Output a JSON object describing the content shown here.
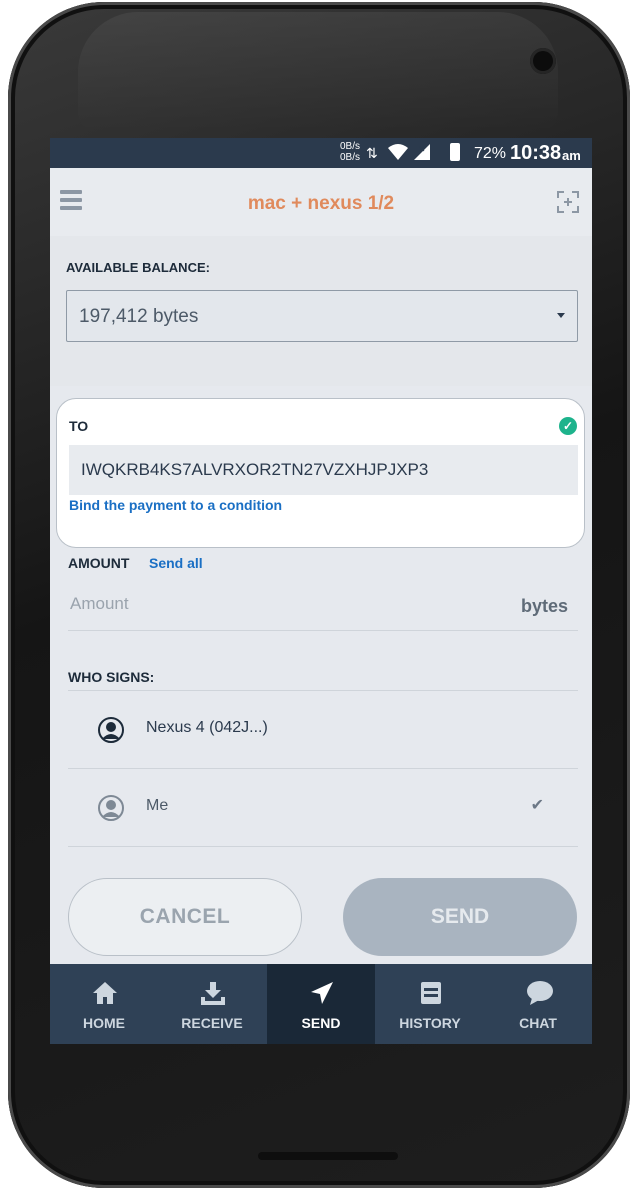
{
  "statusbar": {
    "net_up": "0B/s",
    "net_down": "0B/s",
    "battery_pct": "72%",
    "time": "10:38",
    "ampm": "am"
  },
  "header": {
    "title": "mac + nexus 1/2",
    "menu_icon": "hamburger-icon",
    "scan_icon": "qr-scan-icon"
  },
  "balance": {
    "label": "AVAILABLE BALANCE:",
    "value": "197,412 bytes"
  },
  "to": {
    "label": "TO",
    "address": "IWQKRB4KS7ALVRXOR2TN27VZXHJPJXP3",
    "bind_link": "Bind the payment to a condition"
  },
  "amount": {
    "label": "AMOUNT",
    "send_all": "Send all",
    "placeholder": "Amount",
    "unit": "bytes"
  },
  "signers": {
    "label": "WHO SIGNS:",
    "items": [
      {
        "name": "Nexus 4 (042J...)",
        "checked": false
      },
      {
        "name": "Me",
        "checked": true
      }
    ]
  },
  "actions": {
    "cancel": "CANCEL",
    "send": "SEND"
  },
  "tabs": [
    {
      "label": "HOME",
      "icon": "home-icon"
    },
    {
      "label": "RECEIVE",
      "icon": "receive-icon"
    },
    {
      "label": "SEND",
      "icon": "send-icon",
      "active": true
    },
    {
      "label": "HISTORY",
      "icon": "history-icon"
    },
    {
      "label": "CHAT",
      "icon": "chat-icon"
    }
  ],
  "colors": {
    "accent": "#e08a5c",
    "link": "#1a6fc4",
    "tabbar": "#2f4156",
    "success": "#1db38c"
  }
}
